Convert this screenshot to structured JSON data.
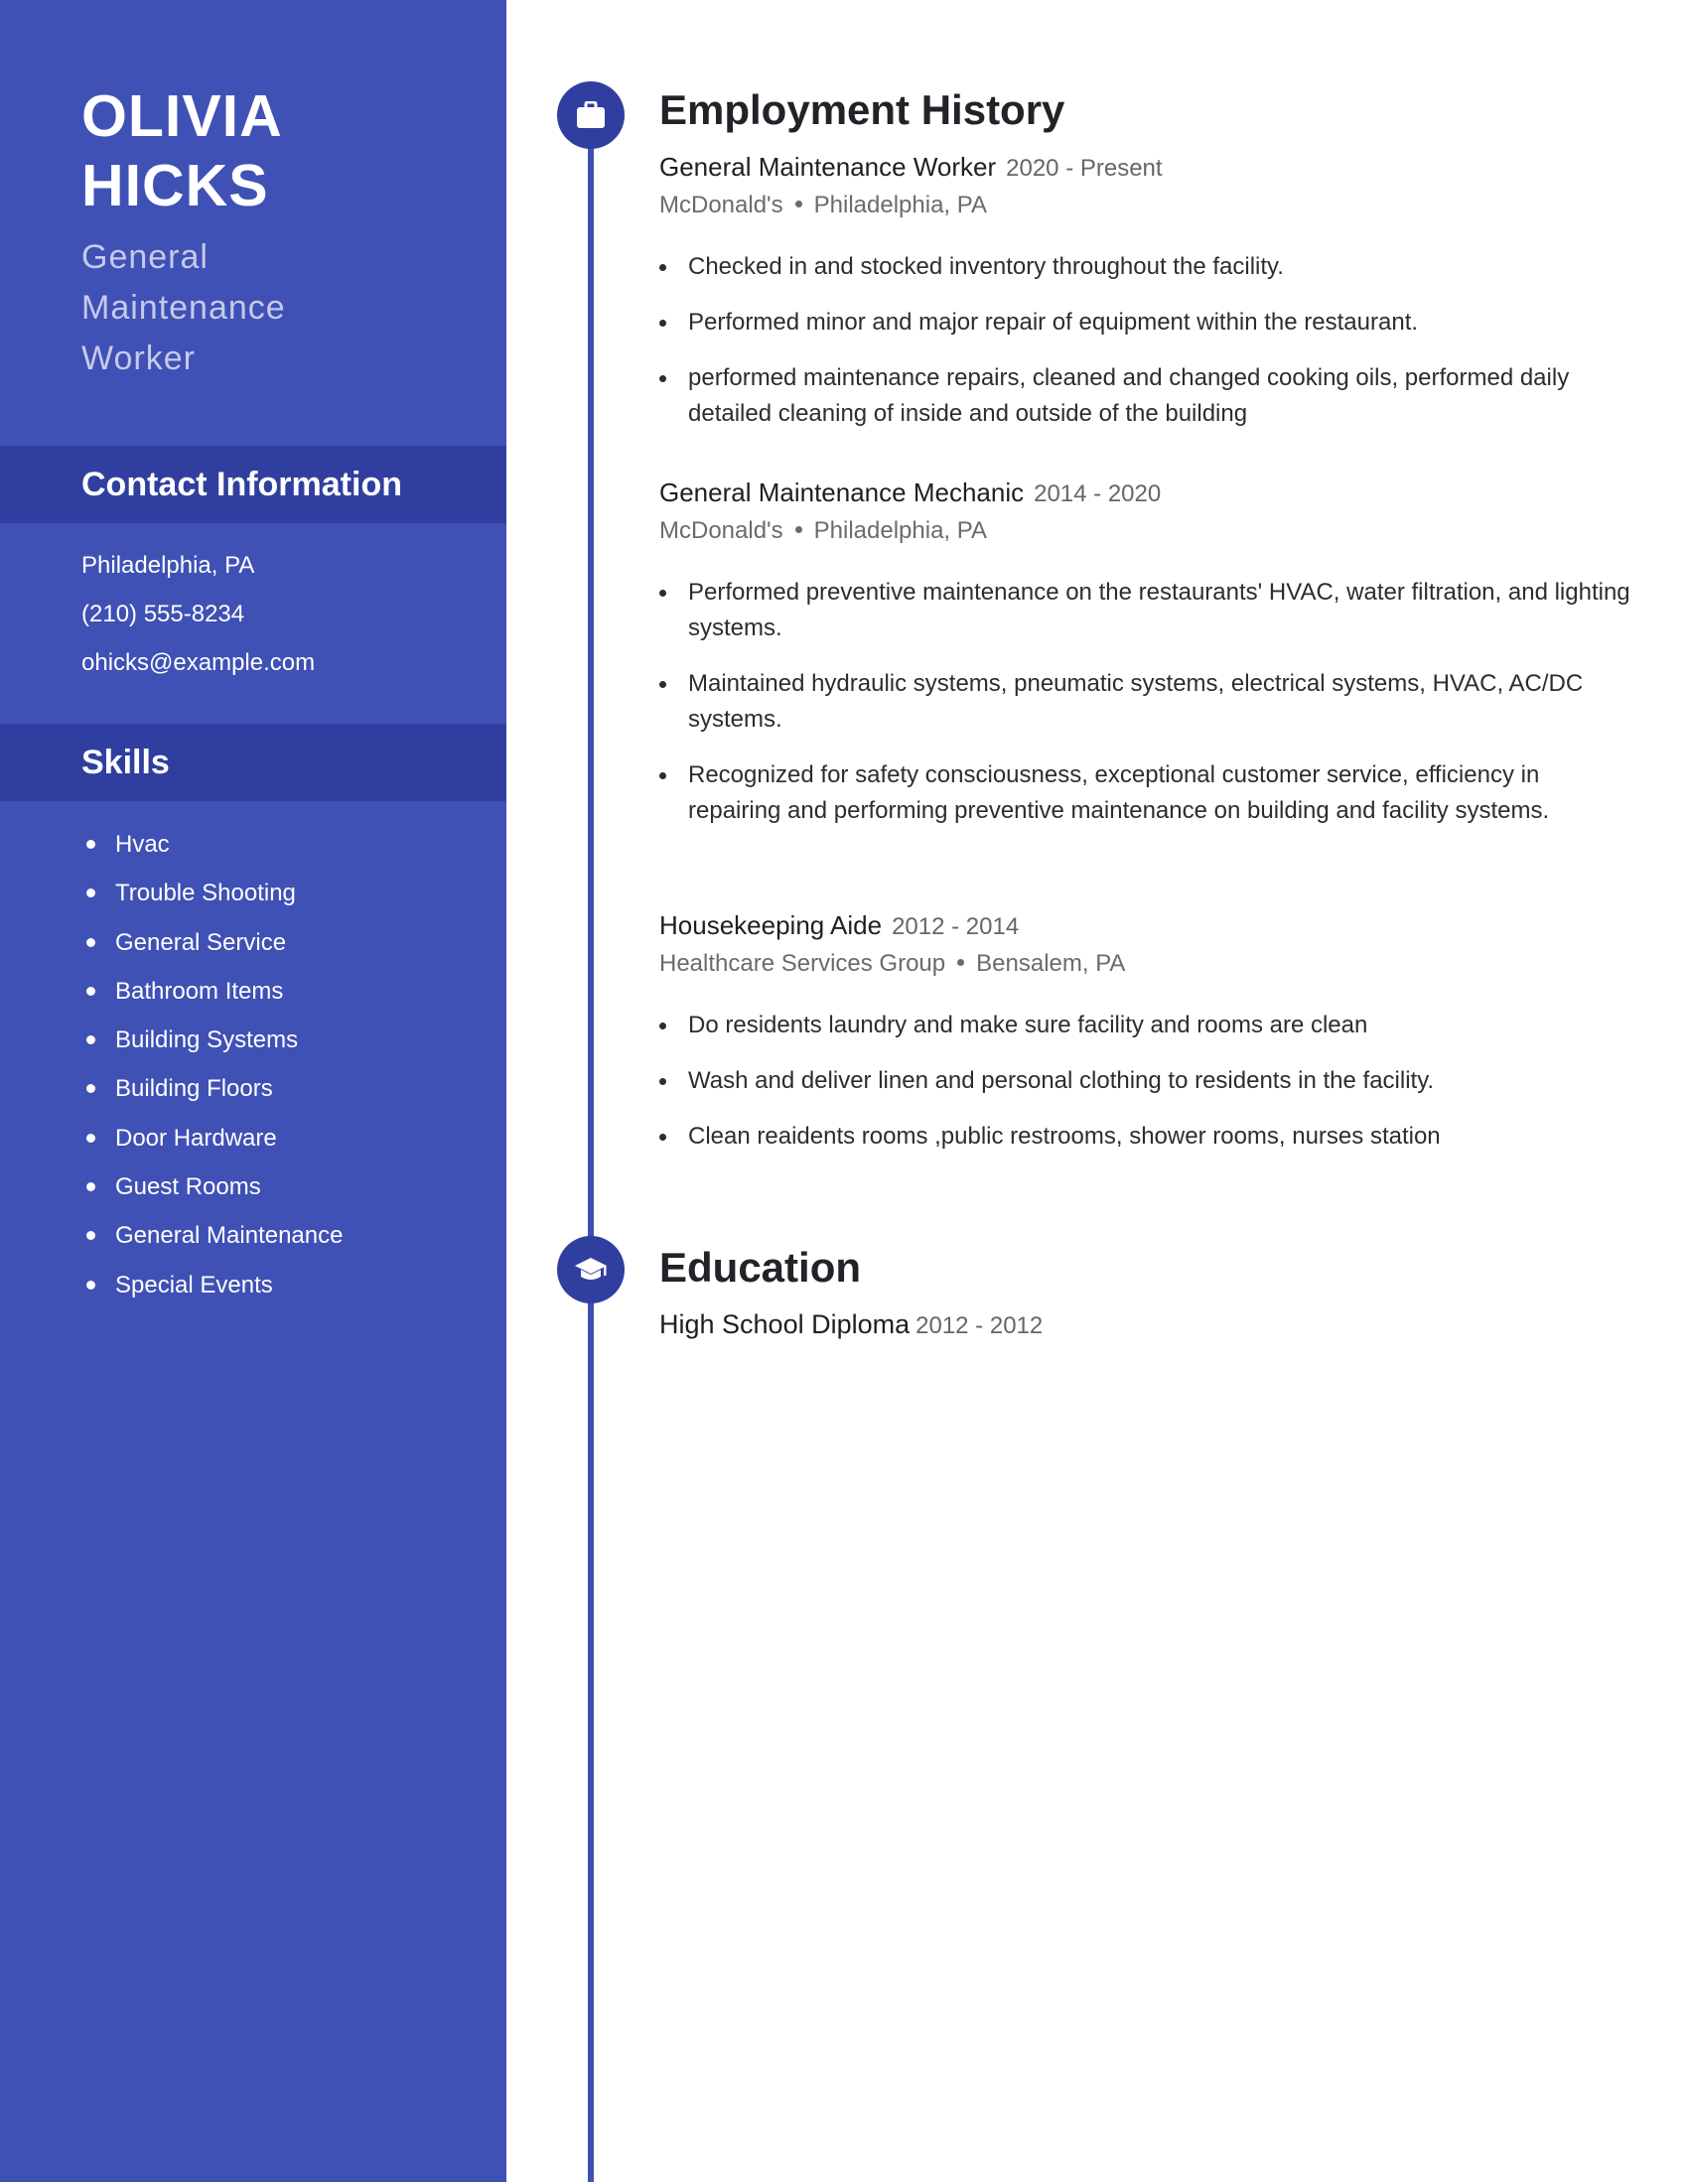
{
  "profile": {
    "first_name": "OLIVIA",
    "last_name": "HICKS",
    "headline": "General Maintenance Worker"
  },
  "contact": {
    "heading": "Contact Information",
    "location": "Philadelphia, PA",
    "phone": "(210) 555-8234",
    "email": "ohicks@example.com"
  },
  "skills": {
    "heading": "Skills",
    "items": [
      "Hvac",
      "Trouble Shooting",
      "General Service",
      "Bathroom Items",
      "Building Systems",
      "Building Floors",
      "Door Hardware",
      "Guest Rooms",
      "General Maintenance",
      "Special Events"
    ]
  },
  "employment": {
    "heading": "Employment History",
    "icon": "briefcase-icon",
    "jobs": [
      {
        "title": "General Maintenance Worker",
        "dates": "2020 - Present",
        "company": "McDonald's",
        "location": "Philadelphia, PA",
        "bullets": [
          "Checked in and stocked inventory throughout the facility.",
          "Performed minor and major repair of equipment within the restaurant.",
          "performed maintenance repairs, cleaned and changed cooking oils, performed daily detailed cleaning of inside and outside of the building"
        ]
      },
      {
        "title": "General Maintenance Mechanic",
        "dates": "2014 - 2020",
        "company": "McDonald's",
        "location": "Philadelphia, PA",
        "bullets": [
          "Performed preventive maintenance on the restaurants' HVAC, water filtration, and lighting systems.",
          "Maintained hydraulic systems, pneumatic systems, electrical systems, HVAC, AC/DC systems.",
          "Recognized for safety consciousness, exceptional customer service, efficiency in repairing and performing preventive maintenance on building and facility systems."
        ]
      },
      {
        "title": "Housekeeping Aide",
        "dates": "2012 - 2014",
        "company": "Healthcare Services Group",
        "location": "Bensalem, PA",
        "bullets": [
          "Do residents laundry and make sure facility and rooms are clean",
          "Wash and deliver linen and personal clothing to residents in the facility.",
          "Clean reaidents rooms ,public restrooms, shower rooms, nurses station"
        ]
      }
    ]
  },
  "education": {
    "heading": "Education",
    "icon": "graduation-cap-icon",
    "entries": [
      {
        "degree": "High School Diploma",
        "dates": "2012 - 2012"
      }
    ]
  },
  "colors": {
    "sidebar": "#3f51b5",
    "sidebar_band": "#303f9f",
    "headline": "#c5cae9",
    "timeline": "#3f51b5",
    "node": "#303f9f"
  }
}
